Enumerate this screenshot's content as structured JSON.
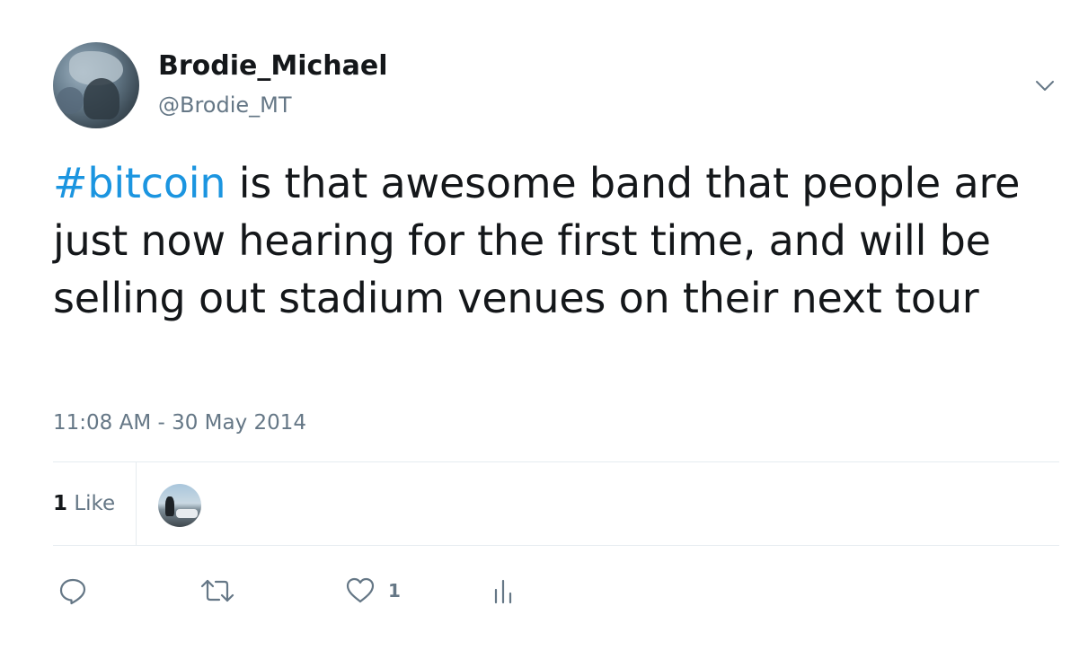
{
  "author": {
    "display_name": "Brodie_Michael",
    "handle": "@Brodie_MT"
  },
  "tweet": {
    "hashtag": "#bitcoin",
    "text": " is that awesome band that people are just now hearing for the first time, and will be selling out stadium venues on their next tour",
    "timestamp": "11:08 AM - 30 May 2014"
  },
  "stats": {
    "likes_count": "1",
    "likes_label": "Like"
  },
  "actions": {
    "reply_icon": "reply-icon",
    "retweet_icon": "retweet-icon",
    "like_icon": "heart-icon",
    "like_count": "1",
    "analytics_icon": "analytics-icon"
  },
  "colors": {
    "text": "#14171a",
    "secondary": "#657786",
    "link": "#1b95e0",
    "divider": "#e6ecf0"
  }
}
